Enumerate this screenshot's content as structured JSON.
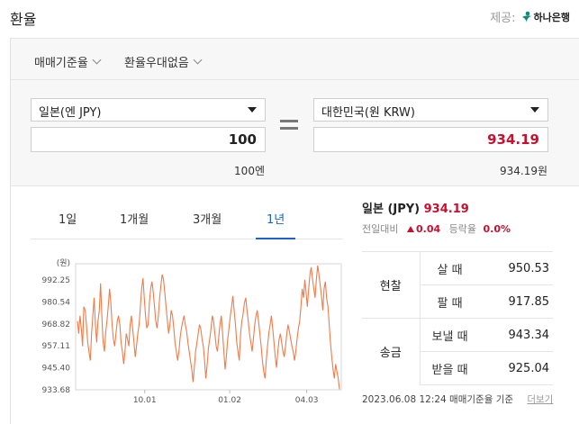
{
  "header": {
    "title": "환율",
    "provider_label": "제공:",
    "provider_name": "하나은행"
  },
  "selectors": {
    "rate_type": "매매기준율",
    "preferential": "환율우대없음"
  },
  "converter": {
    "from_currency": "일본(엔 JPY)",
    "from_amount": "100",
    "from_sub": "100엔",
    "to_currency": "대한민국(원 KRW)",
    "to_amount": "934.19",
    "to_sub": "934.19원"
  },
  "tabs": [
    "1일",
    "1개월",
    "3개월",
    "1년"
  ],
  "active_tab": "1년",
  "summary": {
    "pair": "일본 (JPY)",
    "rate": "934.19",
    "change_label": "전일대비",
    "change": "0.04",
    "pct_label": "등락율",
    "pct": "0.0%"
  },
  "rates": {
    "cash_group": "현찰",
    "buy_label": "살 때",
    "buy": "950.53",
    "sell_label": "팔 때",
    "sell": "917.85",
    "remit_group": "송금",
    "send_label": "보낼 때",
    "send": "943.34",
    "recv_label": "받을 때",
    "recv": "925.04"
  },
  "footer": {
    "timestamp": "2023.06.08 12:24 매매기준율 기준",
    "more": "더보기"
  },
  "colors": {
    "accent_blue": "#1a63c9",
    "rate_red": "#c8102e",
    "line": "#f07b4a"
  },
  "chart_data": {
    "type": "line",
    "unit_label": "(원)",
    "yticks": [
      "992.25",
      "980.54",
      "968.82",
      "957.11",
      "945.40",
      "933.68"
    ],
    "ylim": [
      933.68,
      1003.96
    ],
    "xticks": [
      "10.01",
      "01.02",
      "04.03"
    ],
    "xtick_positions": [
      0.26,
      0.58,
      0.87
    ],
    "series": [
      {
        "values": [
          972,
          965,
          975,
          968,
          958,
          980,
          978,
          970,
          960,
          955,
          950,
          965,
          975,
          985,
          970,
          960,
          972,
          978,
          993,
          975,
          960,
          955,
          966,
          972,
          980,
          990,
          982,
          970,
          962,
          958,
          965,
          972,
          975,
          970,
          960,
          955,
          948,
          955,
          965,
          962,
          958,
          970,
          975,
          968,
          960,
          952,
          958,
          965,
          970,
          980,
          990,
          996,
          985,
          975,
          968,
          970,
          982,
          990,
          994,
          988,
          980,
          972,
          968,
          975,
          985,
          992,
          998,
          995,
          988,
          980,
          972,
          965,
          970,
          978,
          975,
          968,
          960,
          955,
          950,
          955,
          963,
          968,
          972,
          975,
          970,
          966,
          960,
          955,
          950,
          945,
          938,
          946,
          955,
          960,
          965,
          970,
          968,
          962,
          958,
          950,
          940,
          948,
          957,
          962,
          968,
          975,
          972,
          965,
          958,
          955,
          963,
          970,
          975,
          965,
          955,
          945,
          953,
          962,
          968,
          975,
          980,
          986,
          978,
          970,
          960,
          955,
          950,
          965,
          972,
          976,
          982,
          985,
          978,
          972,
          965,
          960,
          955,
          962,
          970,
          975,
          978,
          972,
          965,
          958,
          950,
          944,
          940,
          950,
          958,
          965,
          970,
          975,
          968,
          960,
          952,
          946,
          955,
          962,
          965,
          960,
          955,
          952,
          958,
          965,
          970,
          966,
          962,
          958,
          955,
          950,
          955,
          962,
          968,
          972,
          980,
          990,
          985,
          995,
          988,
          980,
          990,
          998,
          1002,
          996,
          990,
          985,
          995,
          1003,
          998,
          992,
          986,
          978,
          990,
          994,
          985,
          980,
          970,
          960,
          952,
          945,
          940,
          948,
          944,
          940,
          934
        ]
      }
    ]
  }
}
